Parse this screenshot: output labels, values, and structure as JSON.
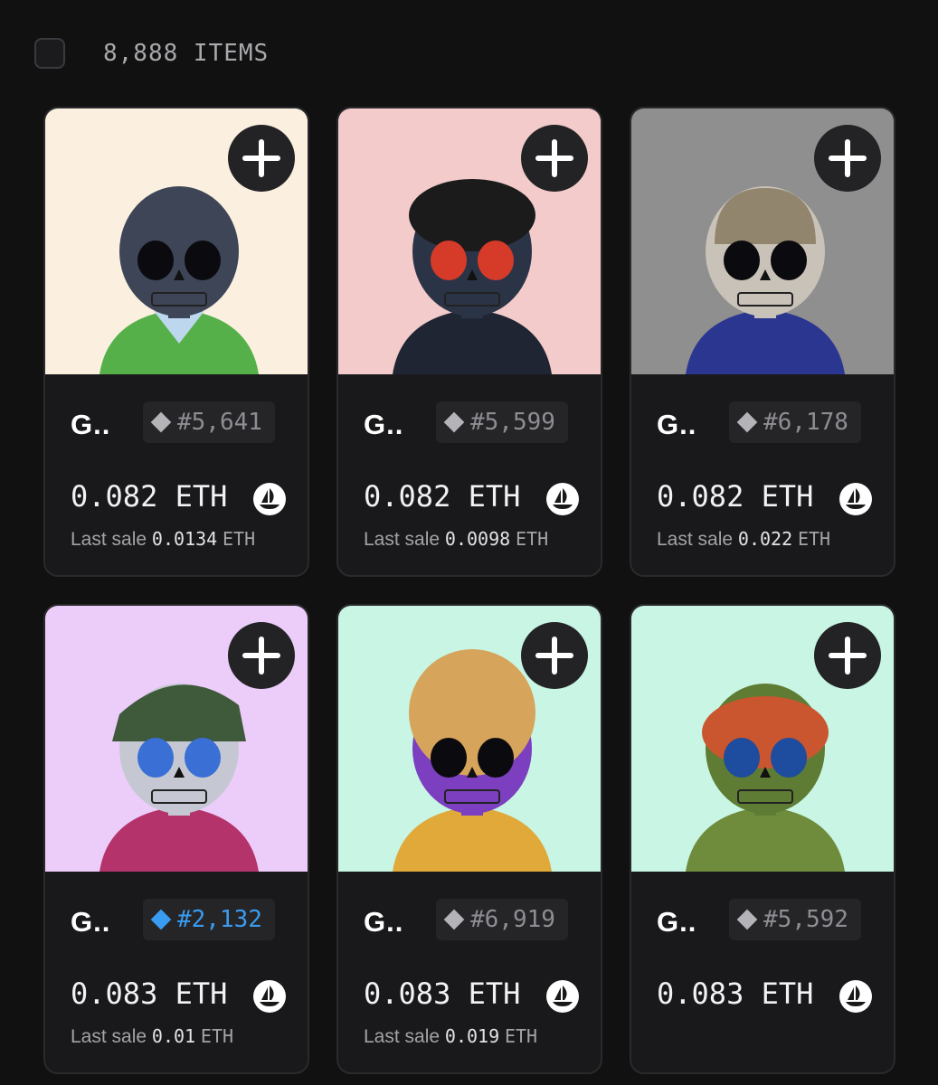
{
  "header": {
    "items_count": "8,888 ITEMS"
  },
  "cards": [
    {
      "name": "G..",
      "token_id": "#5,641",
      "price": "0.082 ETH",
      "last_sale_label": "Last sale",
      "last_sale_value": "0.0134",
      "last_sale_unit": "ETH",
      "bg": "#fbf0df",
      "rare": false
    },
    {
      "name": "G..",
      "token_id": "#5,599",
      "price": "0.082 ETH",
      "last_sale_label": "Last sale",
      "last_sale_value": "0.0098",
      "last_sale_unit": "ETH",
      "bg": "#f3cbca",
      "rare": false
    },
    {
      "name": "G..",
      "token_id": "#6,178",
      "price": "0.082 ETH",
      "last_sale_label": "Last sale",
      "last_sale_value": "0.022",
      "last_sale_unit": "ETH",
      "bg": "#8f8f8f",
      "rare": false
    },
    {
      "name": "G..",
      "token_id": "#2,132",
      "price": "0.083 ETH",
      "last_sale_label": "Last sale",
      "last_sale_value": "0.01",
      "last_sale_unit": "ETH",
      "bg": "#eccdfa",
      "rare": true
    },
    {
      "name": "G..",
      "token_id": "#6,919",
      "price": "0.083 ETH",
      "last_sale_label": "Last sale",
      "last_sale_value": "0.019",
      "last_sale_unit": "ETH",
      "bg": "#c9f5e4",
      "rare": false
    },
    {
      "name": "G..",
      "token_id": "#5,592",
      "price": "0.083 ETH",
      "last_sale_label": "",
      "last_sale_value": "",
      "last_sale_unit": "",
      "bg": "#c9f5e4",
      "rare": false
    }
  ],
  "icons": {
    "add": "plus-icon",
    "marketplace": "opensea-icon",
    "token": "diamond-icon",
    "select": "checkbox-icon"
  },
  "colors": {
    "background": "#111112",
    "card": "#19191b",
    "rare_accent": "#3a9cf0"
  }
}
